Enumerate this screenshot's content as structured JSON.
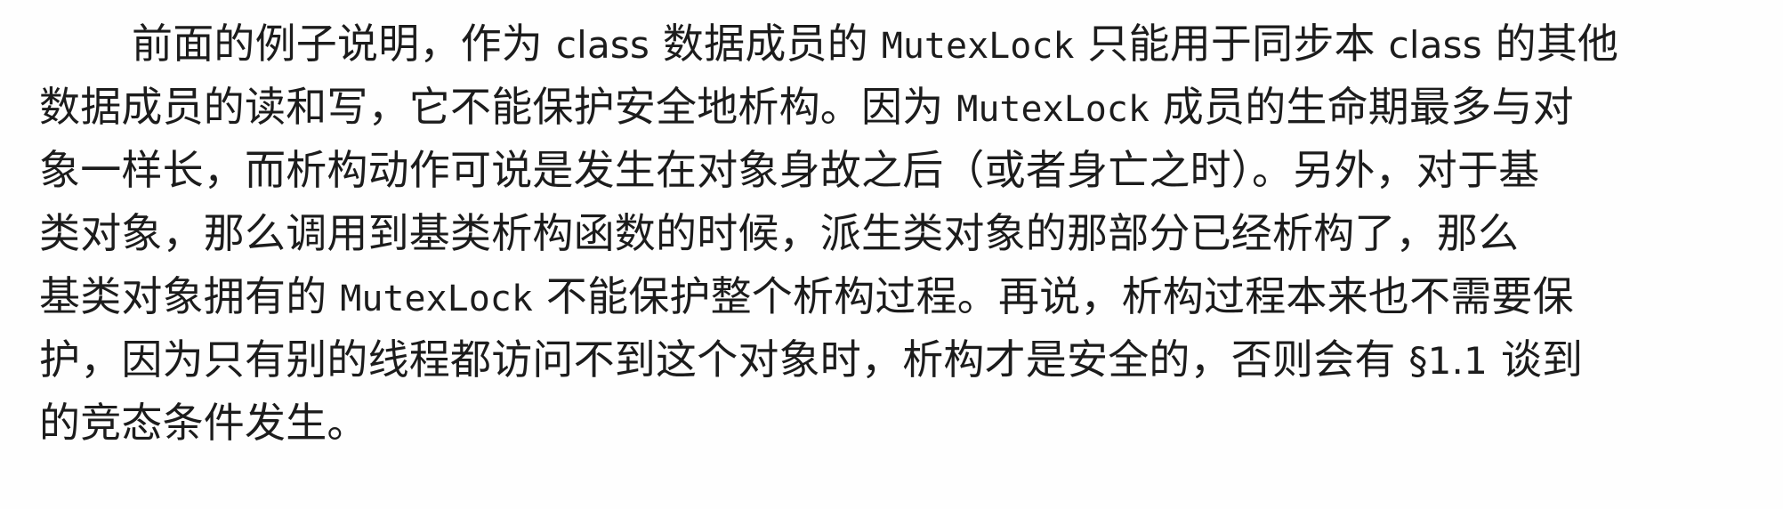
{
  "paragraph": {
    "lines": [
      {
        "segments": [
          {
            "text": "前面的例子说明，作为 ",
            "style": "cjk"
          },
          {
            "text": "class",
            "style": "latin"
          },
          {
            "text": " 数据成员的 ",
            "style": "cjk"
          },
          {
            "text": "MutexLock",
            "style": "mono"
          },
          {
            "text": " 只能用于同步本 ",
            "style": "cjk"
          },
          {
            "text": "class",
            "style": "latin"
          },
          {
            "text": " 的其他",
            "style": "cjk"
          }
        ]
      },
      {
        "segments": [
          {
            "text": "数据成员的读和写，它不能保护安全地析构。因为 ",
            "style": "cjk"
          },
          {
            "text": "MutexLock",
            "style": "mono"
          },
          {
            "text": " 成员的生命期最多与对",
            "style": "cjk"
          }
        ]
      },
      {
        "segments": [
          {
            "text": "象一样长，而析构动作可说是发生在对象身故之后（或者身亡之时）。另外，对于基",
            "style": "cjk"
          }
        ]
      },
      {
        "segments": [
          {
            "text": "类对象，那么调用到基类析构函数的时候，派生类对象的那部分已经析构了，那么",
            "style": "cjk"
          }
        ]
      },
      {
        "segments": [
          {
            "text": "基类对象拥有的 ",
            "style": "cjk"
          },
          {
            "text": "MutexLock",
            "style": "mono"
          },
          {
            "text": " 不能保护整个析构过程。再说，析构过程本来也不需要保",
            "style": "cjk"
          }
        ]
      },
      {
        "segments": [
          {
            "text": "护，因为只有别的线程都访问不到这个对象时，析构才是安全的，否则会有 ",
            "style": "cjk"
          },
          {
            "text": "§1.1",
            "style": "latin"
          },
          {
            "text": " 谈到",
            "style": "cjk"
          }
        ]
      },
      {
        "segments": [
          {
            "text": "的竞态条件发生。",
            "style": "cjk"
          }
        ]
      }
    ]
  }
}
